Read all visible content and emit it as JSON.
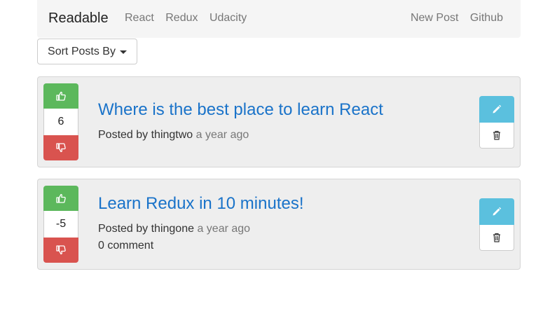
{
  "navbar": {
    "brand": "Readable",
    "categories": [
      "React",
      "Redux",
      "Udacity"
    ],
    "new_post": "New Post",
    "github": "Github"
  },
  "sort": {
    "label": "Sort Posts By",
    "icon": "caret-down-icon"
  },
  "posts": [
    {
      "score": "6",
      "title": "Where is the best place to learn React",
      "posted_by": "Posted by thingtwo",
      "time": "a year ago",
      "comments": ""
    },
    {
      "score": "-5",
      "title": "Learn Redux in 10 minutes!",
      "posted_by": "Posted by thingone",
      "time": "a year ago",
      "comments": "0 comment"
    }
  ],
  "colors": {
    "upvote": "#5cb85c",
    "downvote": "#d9534f",
    "edit": "#5bc0de",
    "title_link": "#1a73c9"
  },
  "icons": {
    "upvote": "thumbs-up-icon",
    "downvote": "thumbs-down-icon",
    "edit": "pencil-icon",
    "delete": "trash-icon"
  }
}
